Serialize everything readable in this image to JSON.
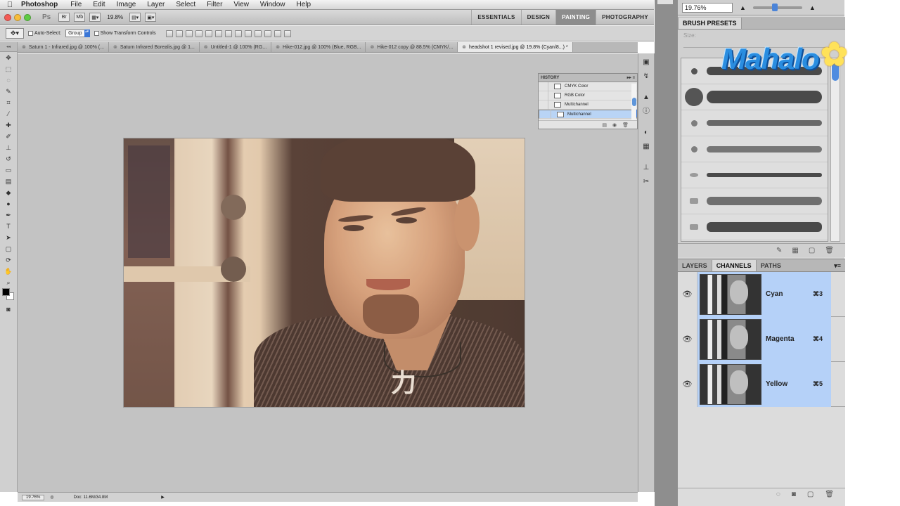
{
  "menubar": {
    "app_name": "Photoshop",
    "items": [
      "File",
      "Edit",
      "Image",
      "Layer",
      "Select",
      "Filter",
      "View",
      "Window",
      "Help"
    ]
  },
  "appbar": {
    "logo": "Ps",
    "zoom": "19.8%",
    "workspaces": [
      "ESSENTIALS",
      "DESIGN",
      "PAINTING",
      "PHOTOGRAPHY"
    ],
    "active_workspace": "PAINTING"
  },
  "options": {
    "auto_select_label": "Auto-Select:",
    "auto_select_value": "Group",
    "transform_label": "Show Transform Controls"
  },
  "doc_tabs": [
    {
      "label": "Saturn 1 - Infrared.jpg @ 100% (...",
      "active": false
    },
    {
      "label": "Saturn Infrared Borealis.jpg @ 1...",
      "active": false
    },
    {
      "label": "Untitled-1 @ 100% (RG...",
      "active": false
    },
    {
      "label": "Hike-012.jpg @ 100% (Blue, RGB...",
      "active": false
    },
    {
      "label": "Hike-012 copy @ 88.5% (CMYK/...",
      "active": false
    },
    {
      "label": "headshot 1 revised.jpg @ 19.8% (Cyan/8...) *",
      "active": true
    }
  ],
  "history": {
    "title": "HISTORY",
    "items": [
      {
        "label": "CMYK Color",
        "selected": false
      },
      {
        "label": "RGB Color",
        "selected": false
      },
      {
        "label": "Multichannel",
        "selected": false
      },
      {
        "label": "Multichannel",
        "selected": true
      }
    ]
  },
  "statusbar": {
    "zoom": "19.76%",
    "doc_info": "Doc: 11.6M/34.8M"
  },
  "right_dock": {
    "zoom_value": "19.76%",
    "zoom_slider_fraction": 0.45
  },
  "brush_presets": {
    "title": "BRUSH PRESETS",
    "size_label": "Size:"
  },
  "watermark": {
    "text": "Mahalo"
  },
  "channels_panel": {
    "tabs": [
      "LAYERS",
      "CHANNELS",
      "PATHS"
    ],
    "active_tab": "CHANNELS",
    "channels": [
      {
        "name": "Cyan",
        "shortcut": "⌘3"
      },
      {
        "name": "Magenta",
        "shortcut": "⌘4"
      },
      {
        "name": "Yellow",
        "shortcut": "⌘5"
      }
    ]
  },
  "colors": {
    "accent": "#3a76d6",
    "selection": "#b5d1f8",
    "active_workspace": "#8d8d8d"
  }
}
